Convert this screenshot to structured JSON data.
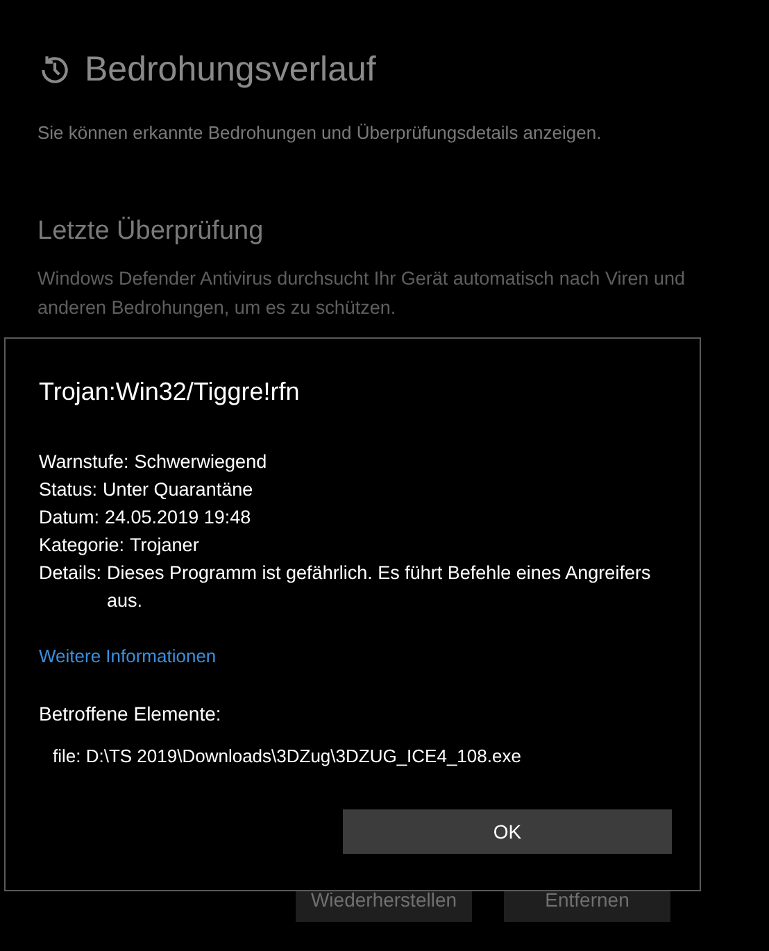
{
  "page": {
    "title": "Bedrohungsverlauf",
    "subtitle": "Sie können erkannte Bedrohungen und Überprüfungsdetails anzeigen.",
    "section_title": "Letzte Überprüfung",
    "section_text": "Windows Defender Antivirus durchsucht Ihr Gerät automatisch nach Viren und anderen Bedrohungen, um es zu schützen.",
    "buttons": [
      "Wiederherstellen",
      "Entfernen"
    ]
  },
  "dialog": {
    "title": "Trojan:Win32/Tiggre!rfn",
    "fields": [
      {
        "label": "Warnstufe:",
        "value": "Schwerwiegend"
      },
      {
        "label": "Status:",
        "value": "Unter Quarantäne"
      },
      {
        "label": "Datum:",
        "value": "24.05.2019 19:48"
      },
      {
        "label": "Kategorie:",
        "value": "Trojaner"
      },
      {
        "label": "Details:",
        "value": "Dieses Programm ist gefährlich. Es führt Befehle eines Angreifers aus."
      }
    ],
    "link": "Weitere Informationen",
    "affected_title": "Betroffene Elemente:",
    "affected_items": [
      "file: D:\\TS 2019\\Downloads\\3DZug\\3DZUG_ICE4_108.exe"
    ],
    "button": "OK"
  }
}
